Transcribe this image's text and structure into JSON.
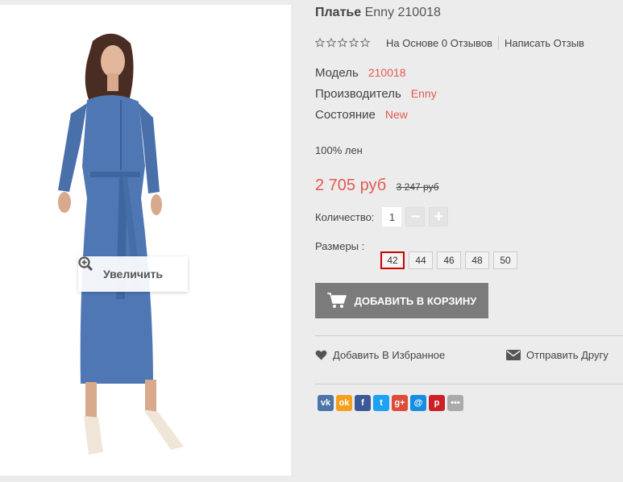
{
  "product": {
    "name": "Платье",
    "brand_code": "Enny 210018",
    "rating_text": "На Основе 0 Отзывов",
    "write_review": "Написать Отзыв",
    "specs": [
      {
        "label": "Модель",
        "value": "210018"
      },
      {
        "label": "Производитель",
        "value": "Enny"
      },
      {
        "label": "Состояние",
        "value": "New"
      }
    ],
    "material": "100% лен",
    "price": "2 705 руб",
    "old_price": "3 247 руб",
    "quantity_label": "Количество:",
    "quantity": "1",
    "sizes_label": "Размеры :",
    "sizes": [
      "42",
      "44",
      "46",
      "48",
      "50"
    ],
    "add_to_cart": "ДОБАВИТЬ В КОРЗИНУ",
    "wishlist": "Добавить В Избранное",
    "send_friend": "Отправить Другу"
  },
  "image": {
    "zoom_label": "Увеличить"
  },
  "social": [
    {
      "icon": "vk-icon",
      "glyph": "vk",
      "color": "#4a76a8"
    },
    {
      "icon": "odnoklassniki-icon",
      "glyph": "ok",
      "color": "#f4a01e"
    },
    {
      "icon": "facebook-icon",
      "glyph": "f",
      "color": "#3b5998"
    },
    {
      "icon": "twitter-icon",
      "glyph": "t",
      "color": "#1da1f2"
    },
    {
      "icon": "googleplus-icon",
      "glyph": "g+",
      "color": "#dd4b39"
    },
    {
      "icon": "mail-icon",
      "glyph": "@",
      "color": "#168de2"
    },
    {
      "icon": "pinterest-icon",
      "glyph": "p",
      "color": "#cb2027"
    },
    {
      "icon": "more-icon",
      "glyph": "•••",
      "color": "#aaaaaa"
    }
  ],
  "colors": {
    "accent": "#e05a50",
    "cart_button": "#7b7b7b",
    "selected_size_border": "#d00000"
  }
}
